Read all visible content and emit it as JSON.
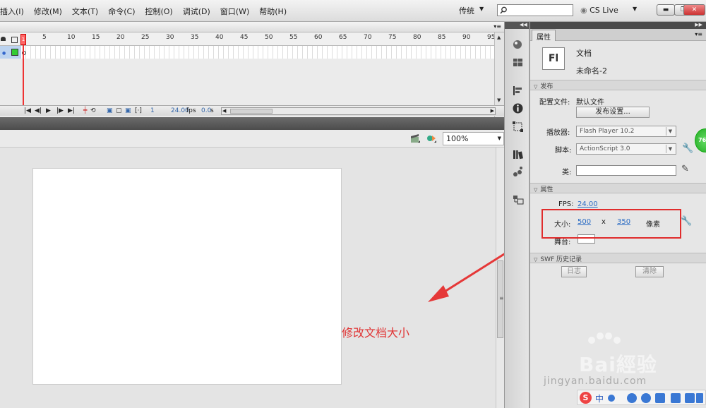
{
  "menubar": {
    "items": [
      "插入(I)",
      "修改(M)",
      "文本(T)",
      "命令(C)",
      "控制(O)",
      "调试(D)",
      "窗口(W)",
      "帮助(H)"
    ],
    "workspace": "传统",
    "search_placeholder": "",
    "cslive": "CS Live",
    "window_buttons": [
      "minimize",
      "restore",
      "close"
    ]
  },
  "timeline": {
    "frame_numbers": [
      "1",
      "5",
      "10",
      "15",
      "20",
      "25",
      "30",
      "35",
      "40",
      "45",
      "50",
      "55",
      "60",
      "65",
      "70",
      "75",
      "80",
      "85",
      "90",
      "95"
    ],
    "current_frame": "1",
    "fps": "24.00",
    "fps_unit": "fps",
    "elapsed": "0.0",
    "elapsed_unit": "s"
  },
  "stage": {
    "zoom": "100%"
  },
  "annotation": "修改文档大小",
  "properties": {
    "tab": "属性",
    "doc_type": "文档",
    "doc_name": "未命名-2",
    "doc_icon_text": "Fl",
    "publish_section": "发布",
    "profile_label": "配置文件:",
    "profile_value": "默认文件",
    "publish_settings_button": "发布设置...",
    "player_label": "播放器:",
    "player_value": "Flash Player 10.2",
    "script_label": "脚本:",
    "script_value": "ActionScript 3.0",
    "class_label": "类:",
    "props_section": "属性",
    "fps_label": "FPS:",
    "fps_value": "24.00",
    "size_label": "大小:",
    "width": "500",
    "size_x": "x",
    "height": "350",
    "unit": "像素",
    "stage_label": "舞台:",
    "swf_section": "SWF 历史记录",
    "log_button": "日志",
    "clear_button": "清除"
  },
  "badge": "76",
  "watermark": {
    "text": "Bai經验",
    "url": "jingyan.baidu.com"
  },
  "ime": {
    "logo": "S",
    "lang": "中"
  }
}
